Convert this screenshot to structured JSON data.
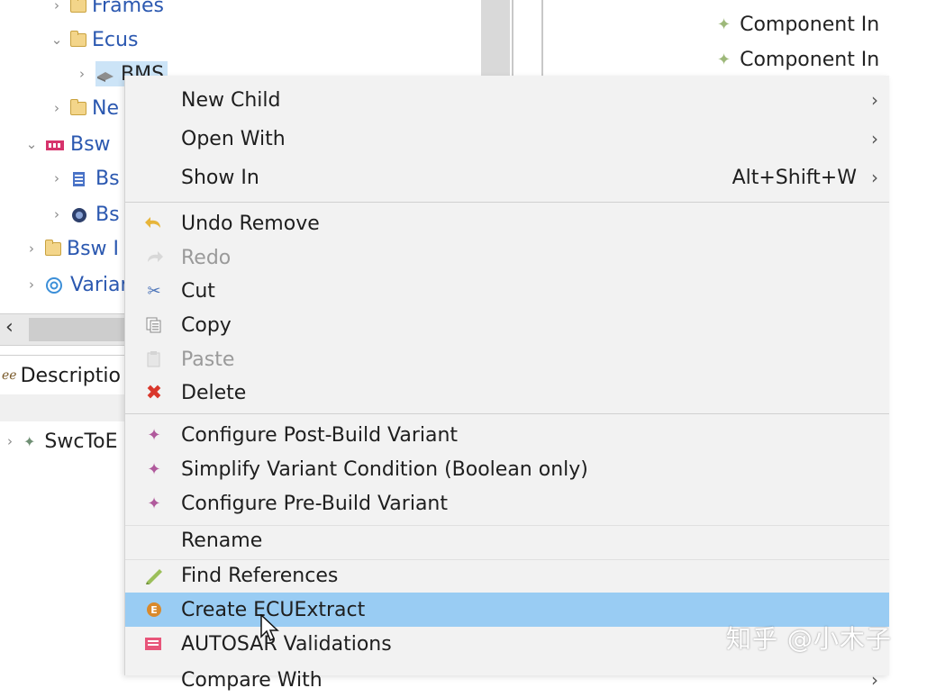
{
  "tree": {
    "items": [
      {
        "label": "Frames"
      },
      {
        "label": "Ecus"
      },
      {
        "label": "BMS"
      },
      {
        "label": "Ne"
      },
      {
        "label": "Bsw"
      },
      {
        "label": "Bs"
      },
      {
        "label": "Bs"
      },
      {
        "label": "Bsw I"
      },
      {
        "label": "Variar"
      }
    ]
  },
  "right_panel": {
    "items": [
      {
        "label": "Component In"
      },
      {
        "label": "Component In"
      }
    ]
  },
  "description_tab": {
    "label": "Descriptio"
  },
  "bottom_tree": {
    "label": "SwcToE"
  },
  "menu": {
    "new_child": "New Child",
    "open_with": "Open With",
    "show_in": "Show In",
    "show_in_shortcut": "Alt+Shift+W",
    "undo_remove": "Undo Remove",
    "redo": "Redo",
    "cut": "Cut",
    "copy": "Copy",
    "paste": "Paste",
    "delete": "Delete",
    "configure_post_build": "Configure Post-Build Variant",
    "simplify_variant": "Simplify Variant Condition (Boolean only)",
    "configure_pre_build": "Configure Pre-Build Variant",
    "rename": "Rename",
    "find_references": "Find References",
    "create_ecu_extract": "Create ECUExtract",
    "autosar_validations": "AUTOSAR Validations",
    "compare_with": "Compare With"
  },
  "colors": {
    "highlight": "#99ccf3",
    "tree_link": "#2b58b0",
    "delete_red": "#d9372b"
  },
  "watermark": "知乎 @小木子"
}
